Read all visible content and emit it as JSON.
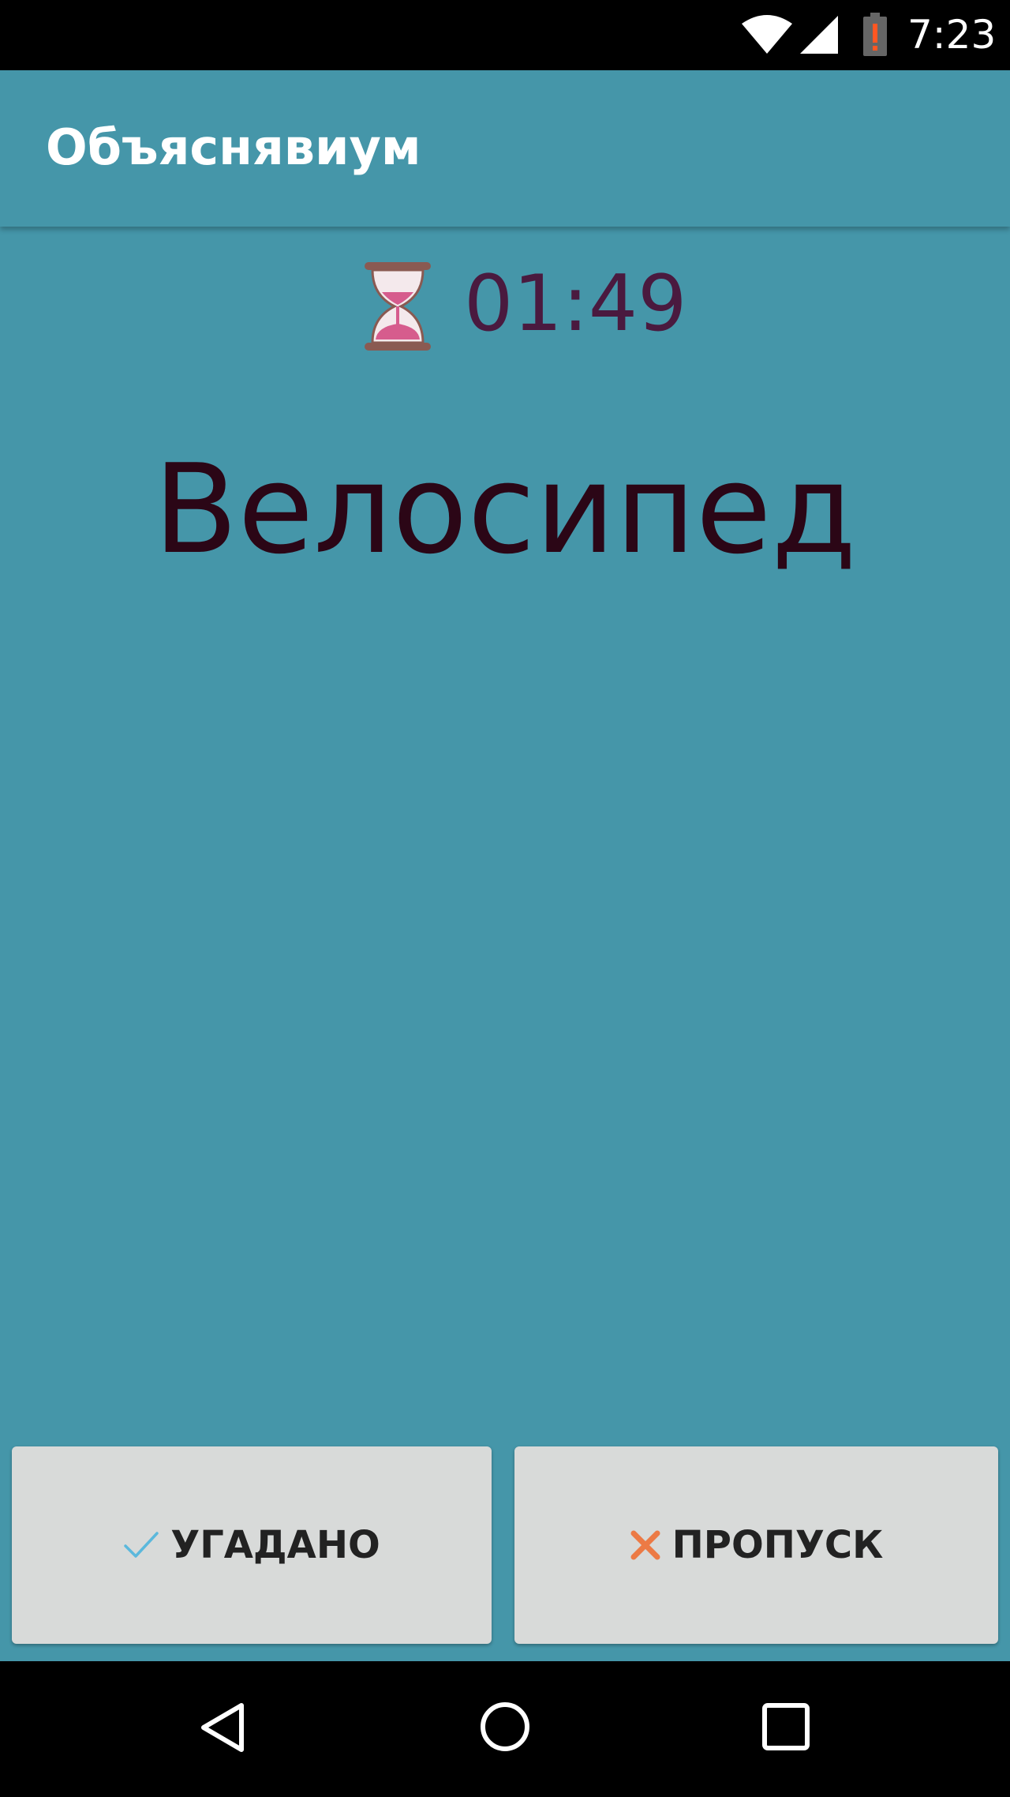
{
  "status_bar": {
    "time": "7:23",
    "icons": [
      "wifi-icon",
      "cell-signal-icon",
      "battery-alert-icon"
    ]
  },
  "app_bar": {
    "title": "Объяснявиум"
  },
  "timer": {
    "icon": "hourglass-icon",
    "value": "01:49"
  },
  "word": "Велосипед",
  "buttons": {
    "guessed": {
      "label": "УГАДАНО",
      "icon": "check-icon",
      "icon_color": "#5bb8dc"
    },
    "skip": {
      "label": "ПРОПУСК",
      "icon": "cross-icon",
      "icon_color": "#ec7a45"
    }
  },
  "nav_bar": {
    "icons": [
      "back-icon",
      "home-icon",
      "recents-icon"
    ]
  },
  "colors": {
    "background": "#4596a9",
    "word": "#2b0616",
    "timer": "#4a1a3f",
    "button": "#d8dad9"
  }
}
